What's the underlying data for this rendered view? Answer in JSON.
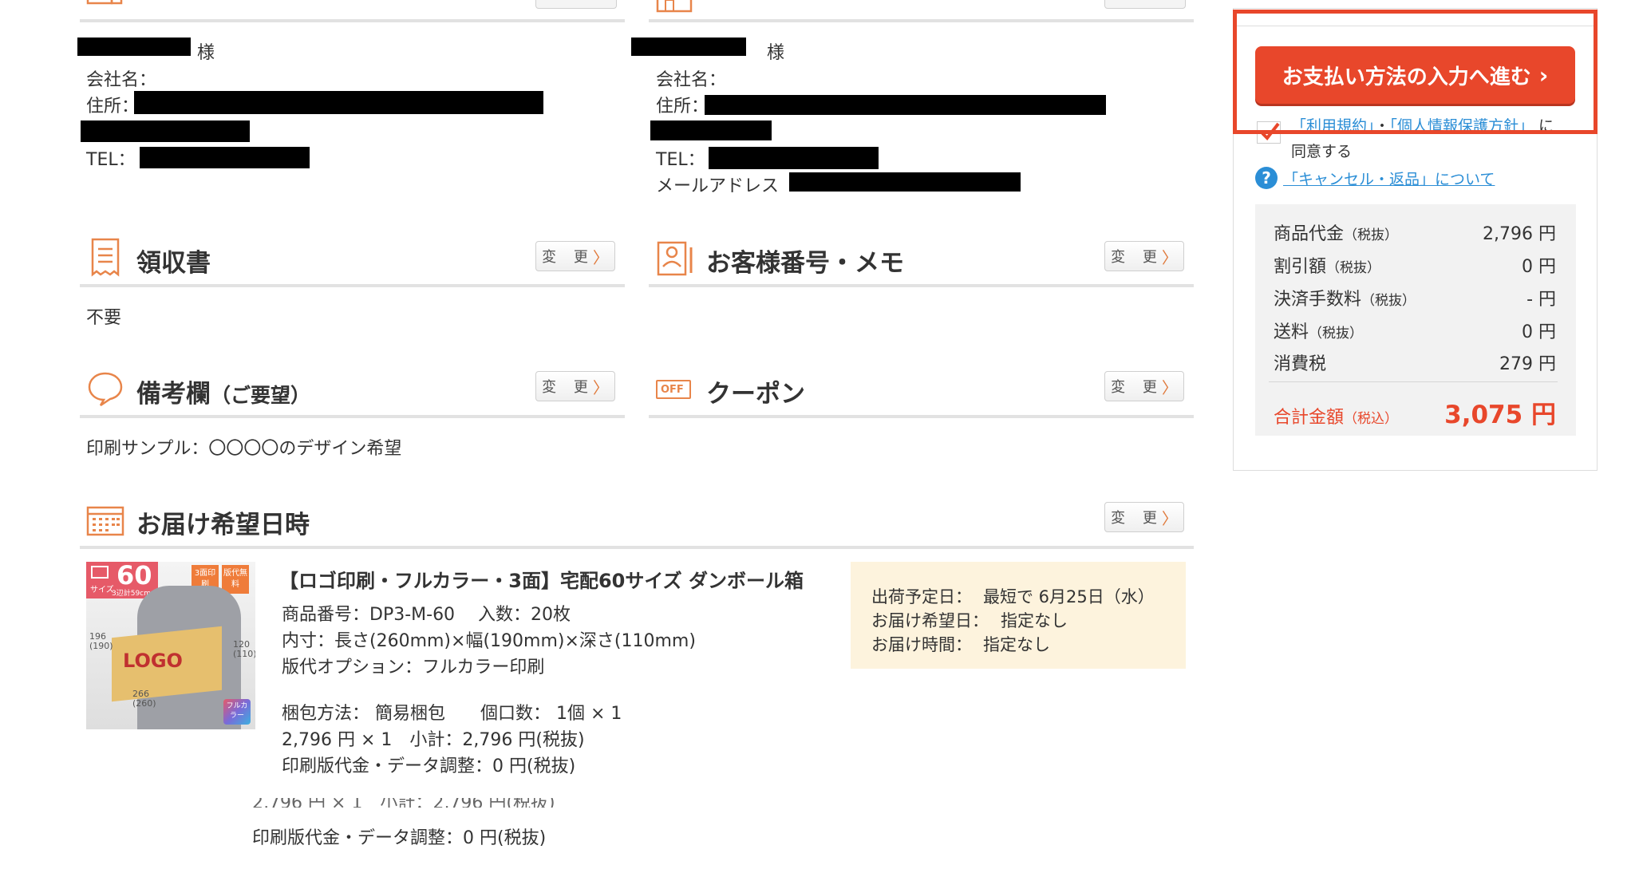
{
  "delivery": {
    "honorific": "様",
    "company_label": "会社名：",
    "address_label": "住所：",
    "tel_label": "TEL："
  },
  "customer": {
    "honorific": "様",
    "company_label": "会社名：",
    "address_label": "住所：",
    "tel_label": "TEL：",
    "email_label": "メールアドレス"
  },
  "receipt": {
    "title": "領収書",
    "value": "不要",
    "change_label": "変 更"
  },
  "customer_number": {
    "title": "お客様番号・メモ",
    "change_label": "変 更"
  },
  "remarks": {
    "title": "備考欄",
    "title_sub": "（ご要望）",
    "value": "印刷サンプル：〇〇〇〇のデザイン希望",
    "change_label": "変 更"
  },
  "coupon": {
    "title": "クーポン",
    "icon_text": "OFF",
    "change_label": "変 更"
  },
  "delivery_date": {
    "title": "お届け希望日時",
    "change_label": "変 更"
  },
  "product": {
    "thumb": {
      "size_num": "60",
      "size_label": "サイズ",
      "total": "3辺計59cm",
      "badge1": "3面印刷",
      "badge2": "版代無料",
      "logo": "LOGO",
      "dim1": "196",
      "dim1b": "(190)",
      "dim2": "120",
      "dim2b": "(110)",
      "dim3": "266",
      "dim3b": "(260)",
      "full": "フルカラー"
    },
    "name": "【ロゴ印刷・フルカラー・3面】宅配60サイズ ダンボール箱",
    "code": "商品番号：DP3-M-60　 入数：20枚",
    "dims": "内寸：長さ(260mm)×幅(190mm)×深さ(110mm)",
    "option": "版代オプション：フルカラー印刷",
    "packing": "梱包方法：  簡易梱包　　個口数：  1個 × 1",
    "price": "2,796 円 × 1　小計：2,796 円(税抜)",
    "print_fee": "印刷版代金・データ調整：0 円(税抜)",
    "print_fee_dup": "印刷版代金・データ調整：0 円(税抜)"
  },
  "shipping_box": {
    "ship_date_label": "出荷予定日：",
    "ship_date_value": "最短で 6月25日（水）",
    "wish_date_label": "お届け希望日：",
    "wish_date_value": "指定なし",
    "wish_time_label": "お届け時間：",
    "wish_time_value": "指定なし"
  },
  "sidebar": {
    "proceed_button": "お支払い方法の入力へ進む",
    "terms_link1": "「利用規約」",
    "terms_sep": "・",
    "terms_link2": "「個人情報保護方針」",
    "terms_suffix": "に",
    "agree": "同意する",
    "cancel_link": "「キャンセル・返品」について",
    "summary": [
      {
        "label": "商品代金",
        "note": "（税抜）",
        "value": "2,796 円"
      },
      {
        "label": "割引額",
        "note": "（税抜）",
        "value": "0 円"
      },
      {
        "label": "決済手数料",
        "note": "（税抜）",
        "value": "- 円"
      },
      {
        "label": "送料",
        "note": "（税抜）",
        "value": "0 円"
      },
      {
        "label": "消費税",
        "note": "",
        "value": "279 円"
      }
    ],
    "total_label": "合計金額",
    "total_note": "（税込）",
    "total_value": "3,075 円"
  },
  "colors": {
    "accent": "#e8472b",
    "orange_icon": "#e8854a",
    "link": "#2b8ed6",
    "note_bg": "#fdf3dd"
  }
}
